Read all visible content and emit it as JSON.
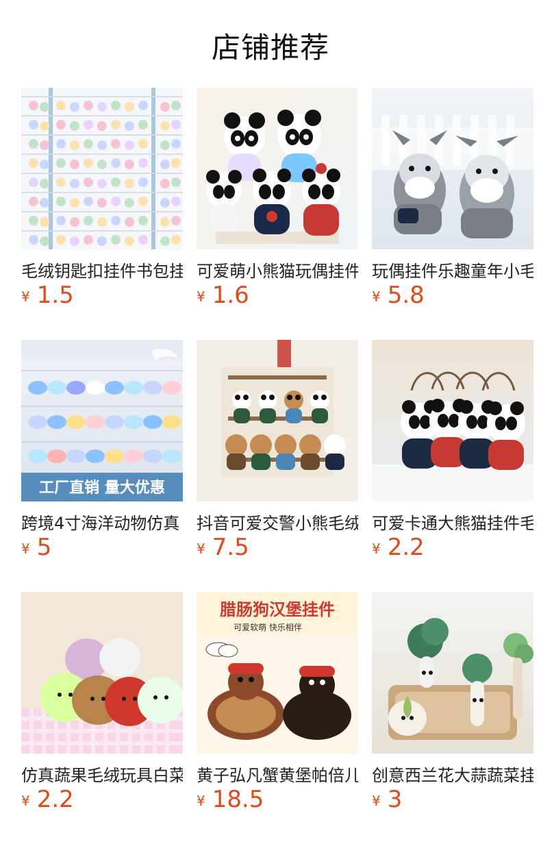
{
  "header": {
    "title": "店铺推荐"
  },
  "currency": "¥",
  "theme": {
    "price_color": "#e04a18",
    "text_color": "#222222"
  },
  "products": [
    {
      "name": "毛绒钥匙扣挂件书包挂",
      "price": "1.5",
      "image": {
        "alt": "plush-keychains-shop-wall",
        "bg": "#e9eef3",
        "accent": "#8bb6d9"
      }
    },
    {
      "name": "可爱萌小熊猫玩偶挂件",
      "price": "1.6",
      "image": {
        "alt": "panda-plush-keychains",
        "bg": "#f4efe6",
        "accent": "#c73a33"
      }
    },
    {
      "name": "玩偶挂件乐趣童年小毛驴",
      "price": "5.8",
      "image": {
        "alt": "donkey-plush-keychains",
        "bg": "#e9f0f5",
        "accent": "#7a7f86"
      }
    },
    {
      "name": "跨境4寸海洋动物仿真",
      "price": "5",
      "image": {
        "alt": "ocean-animals-plush-factory",
        "bg": "#dfe6ef",
        "accent": "#4a86b8",
        "banner": "工厂直销 量大优惠"
      }
    },
    {
      "name": "抖音可爱交警小熊毛绒",
      "price": "7.5",
      "image": {
        "alt": "police-bear-plush",
        "bg": "#f3efe7",
        "accent": "#6b4a2e"
      }
    },
    {
      "name": "可爱卡通大熊猫挂件毛绒",
      "price": "2.2",
      "image": {
        "alt": "panda-sunshine-keychains",
        "bg": "#e7ecef",
        "accent": "#1d2a43"
      }
    },
    {
      "name": "仿真蔬果毛绒玩具白菜",
      "price": "2.2",
      "image": {
        "alt": "vegetable-plush-toys",
        "bg": "#f2e8d9",
        "accent": "#d9b4d9"
      }
    },
    {
      "name": "黄子弘凡蟹黄堡帕倍儿",
      "price": "18.5",
      "image": {
        "alt": "sausage-dog-burger-keychain",
        "bg": "#fff7ea",
        "accent": "#d1382d",
        "headline": "腊肠狗汉堡挂件",
        "subline": "可爱软萌 快乐相伴"
      }
    },
    {
      "name": "创意西兰花大蒜蔬菜挂件",
      "price": "3",
      "image": {
        "alt": "broccoli-garlic-plush",
        "bg": "#eef0ed",
        "accent": "#3f7a5a"
      }
    }
  ]
}
